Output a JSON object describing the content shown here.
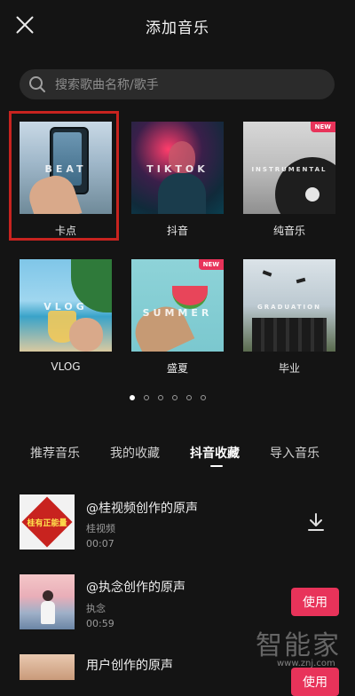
{
  "header": {
    "title": "添加音乐"
  },
  "search": {
    "placeholder": "搜索歌曲名称/歌手"
  },
  "categories": [
    {
      "label": "卡点",
      "overlay": "BEAT",
      "new_badge": "",
      "selected": true
    },
    {
      "label": "抖音",
      "overlay": "TIKTOK",
      "new_badge": ""
    },
    {
      "label": "纯音乐",
      "overlay": "INSTRUMENTAL",
      "new_badge": "NEW"
    },
    {
      "label": "VLOG",
      "overlay": "VLOG",
      "new_badge": ""
    },
    {
      "label": "盛夏",
      "overlay": "SUMMER",
      "new_badge": "NEW"
    },
    {
      "label": "毕业",
      "overlay": "GRADUATION",
      "new_badge": ""
    }
  ],
  "pagination": {
    "total_pages": 6,
    "current_page": 1
  },
  "tabs": [
    {
      "label": "推荐音乐",
      "active": false
    },
    {
      "label": "我的收藏",
      "active": false
    },
    {
      "label": "抖音收藏",
      "active": true
    },
    {
      "label": "导入音乐",
      "active": false
    }
  ],
  "songs": [
    {
      "title": "@桂视频创作的原声",
      "artist": "桂视频",
      "duration": "00:07",
      "action": "download",
      "thumb_text": "桂有正能量"
    },
    {
      "title": "@执念创作的原声",
      "artist": "执念",
      "duration": "00:59",
      "action": "use",
      "action_label": "使用"
    },
    {
      "title": "用户创作的原声",
      "artist": "",
      "duration": "",
      "action": "use",
      "action_label": "使用"
    }
  ],
  "watermark": {
    "text": "智能家",
    "url": "www.znj.com"
  },
  "colors": {
    "accent": "#e8335a",
    "background": "#141414",
    "highlight": "#c8231f"
  }
}
